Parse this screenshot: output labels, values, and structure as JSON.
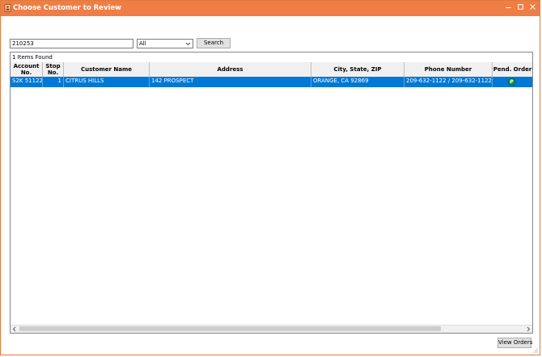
{
  "window": {
    "title": "Choose Customer to Review"
  },
  "search": {
    "value": "210253",
    "filter_value": "All",
    "button_label": "Search"
  },
  "results": {
    "count_text": "1 Items Found",
    "columns": [
      {
        "label": "Account No."
      },
      {
        "label": "Stop No."
      },
      {
        "label": "Customer Name"
      },
      {
        "label": "Address"
      },
      {
        "label": "City, State, ZIP"
      },
      {
        "label": "Phone Number"
      },
      {
        "label": "Pend. Order"
      }
    ],
    "rows": [
      {
        "account_no": "S2K 51122",
        "stop_no": "1",
        "customer_name": "CITRUS HILLS",
        "address": "142 PROSPECT",
        "city_state_zip": "ORANGE, CA  92869",
        "phone": "209-632-1122 / 209-632-1122",
        "pend_order": "P"
      }
    ]
  },
  "footer": {
    "view_orders_label": "View Orders"
  },
  "colors": {
    "titlebar": "#ef7d45",
    "selection": "#0078d7",
    "pending_badge": "#14a03c"
  }
}
